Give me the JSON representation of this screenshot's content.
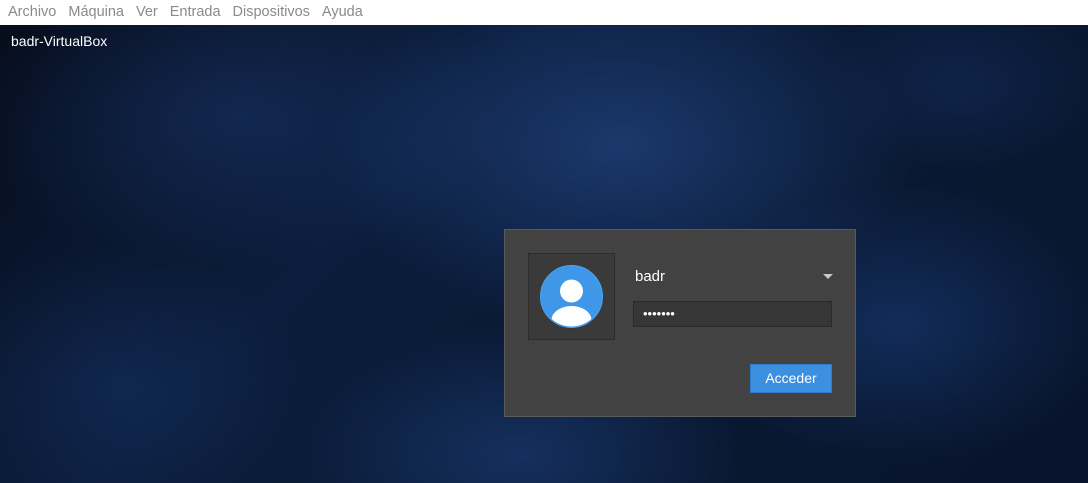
{
  "menubar": {
    "items": [
      {
        "label": "Archivo"
      },
      {
        "label": "Máquina"
      },
      {
        "label": "Ver"
      },
      {
        "label": "Entrada"
      },
      {
        "label": "Dispositivos"
      },
      {
        "label": "Ayuda"
      }
    ]
  },
  "desktop": {
    "hostname": "badr-VirtualBox"
  },
  "login": {
    "username": "badr",
    "password_mask": "•••••••",
    "button_label": "Acceder"
  },
  "colors": {
    "panel_bg": "#424242",
    "button_accent": "#3d8fe0",
    "avatar_circle": "#3f97e8"
  },
  "icons": {
    "avatar": "user-avatar-icon",
    "dropdown": "chevron-down-icon"
  }
}
